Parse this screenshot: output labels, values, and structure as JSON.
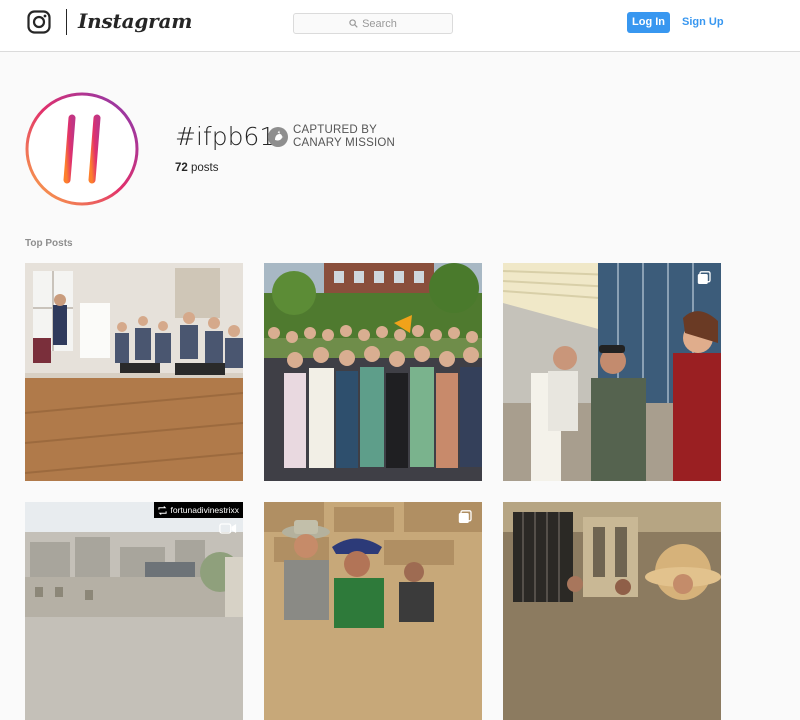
{
  "header": {
    "brand": "Instagram",
    "search_placeholder": "Search",
    "login_label": "Log In",
    "signup_label": "Sign Up",
    "icons": {
      "logo": "instagram-glyph-icon",
      "search": "magnifier-icon"
    }
  },
  "hashtag": {
    "title": "#ifpb61",
    "post_count": "72",
    "post_word": "posts",
    "badge_line1": "CAPTURED BY",
    "badge_line2": "CANARY MISSION",
    "badge_icon": "canary-bird-icon"
  },
  "section": {
    "top_posts_label": "Top Posts"
  },
  "posts": [
    {
      "subject": "group seated in a circle in a room with wooden floor",
      "multi": false
    },
    {
      "subject": "large group photo in front of hedge and buildings",
      "multi": false
    },
    {
      "subject": "men in airport terminal hallway",
      "multi": true
    },
    {
      "subject": "city rooftops view",
      "multi": false,
      "repost_user": "fortunadivinestrixx",
      "repost_icon": "repost-icon",
      "video_icon": "video-camera-icon"
    },
    {
      "subject": "people in hats by stone wall",
      "multi": true
    },
    {
      "subject": "woman in wide-brim hat near iron gate",
      "multi": false
    }
  ],
  "colors": {
    "accent": "#3897f0",
    "border": "#dbdbdb",
    "background": "#fafafa",
    "gradient_start": "#fcaf45",
    "gradient_mid": "#e1306c",
    "gradient_end": "#833ab4"
  }
}
